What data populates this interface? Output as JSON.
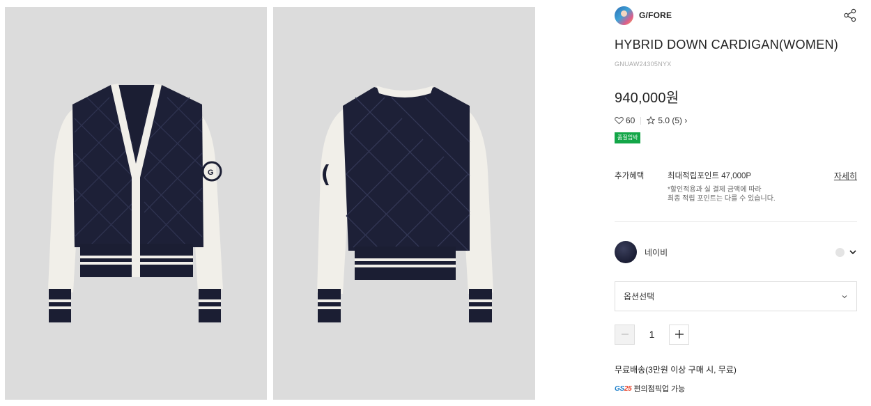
{
  "gallery": {
    "images": [
      {
        "alt": "front-view"
      },
      {
        "alt": "back-view"
      }
    ]
  },
  "brand": {
    "name": "G/FORE",
    "logo_icon": "brand-avatar-icon",
    "share_icon": "share-icon"
  },
  "product": {
    "title": "HYBRID DOWN CARDIGAN(WOMEN)",
    "sku": "GNUAW24305NYX",
    "price": "940,000원",
    "likes": "60",
    "rating": "5.0",
    "review_count": "(5)",
    "review_arrow": "›",
    "badge": "품질임박"
  },
  "benefit": {
    "label": "추가혜택",
    "points": "최대적립포인트 47,000P",
    "note_line1": "*할인적용과 실 결제 금액에 따라",
    "note_line2": "최종 적립 포인트는 다를 수 있습니다.",
    "detail_link": "자세히"
  },
  "color": {
    "name": "네이비",
    "swatch_color": "#1d2037"
  },
  "option": {
    "placeholder": "옵션선택"
  },
  "quantity": {
    "value": "1"
  },
  "shipping": {
    "text": "무료배송(3만원 이상 구매 시, 무료)",
    "pickup_logo_gs": "GS",
    "pickup_logo_num": "25",
    "pickup_text": "편의점픽업 가능"
  },
  "colors": {
    "accent_green": "#13a648",
    "navy": "#1d2037",
    "photo_bg": "#dcdcdc"
  }
}
